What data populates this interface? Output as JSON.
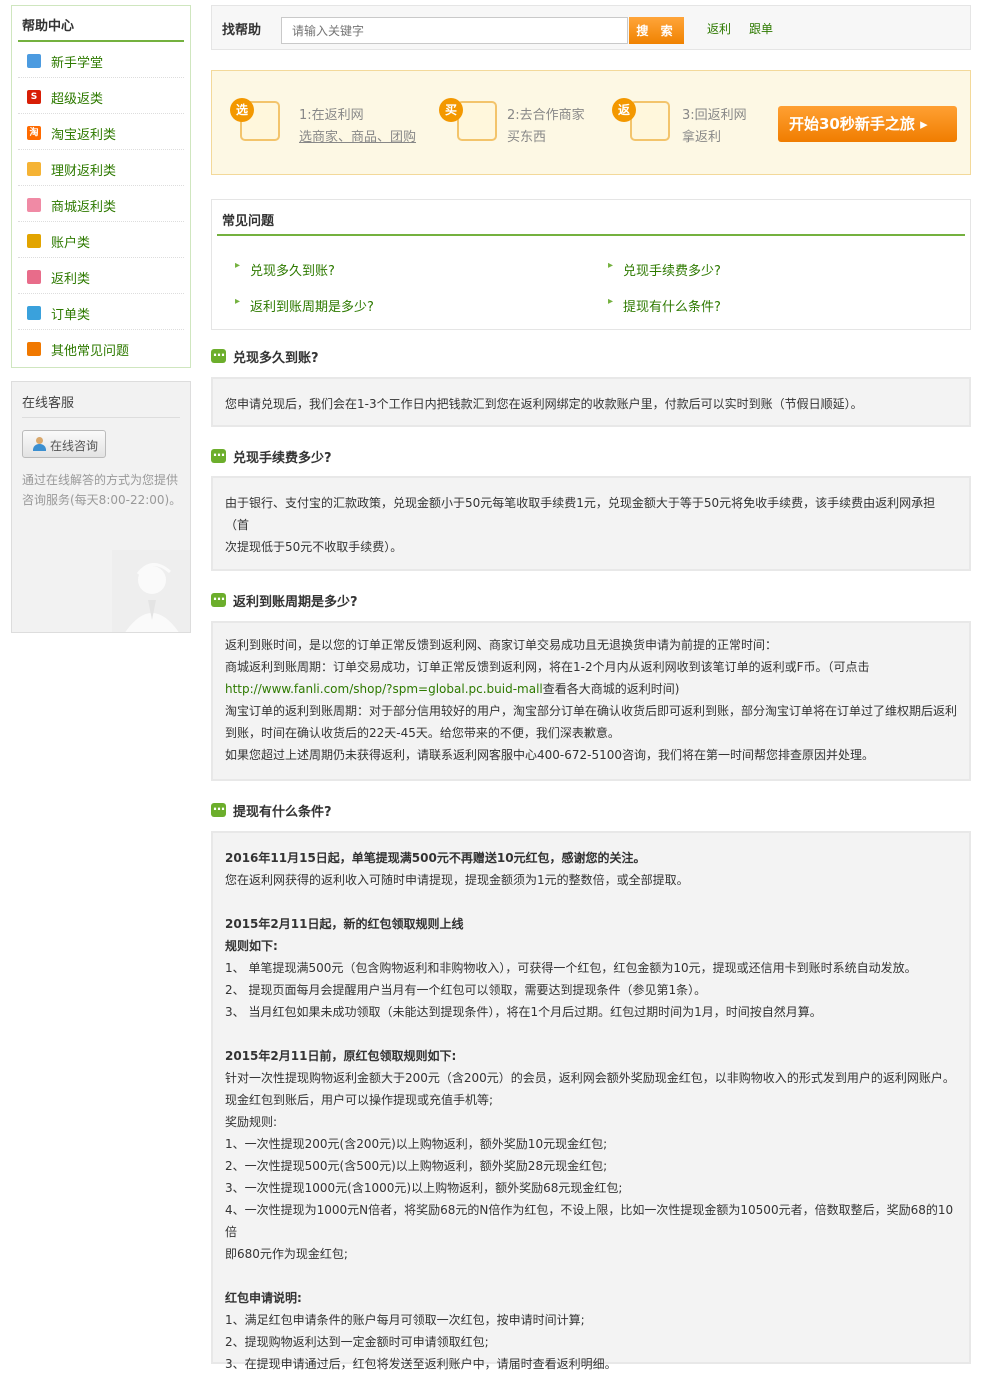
{
  "sidebar": {
    "title": "帮助中心",
    "items": [
      {
        "label": "新手学堂",
        "icon": "monitor-icon",
        "color": "#4c9be0",
        "glyph": ""
      },
      {
        "label": "超级返类",
        "icon": "super-s-icon",
        "color": "#d81e06",
        "glyph": "S"
      },
      {
        "label": "淘宝返利类",
        "icon": "taobao-icon",
        "color": "#ff6a00",
        "glyph": "淘"
      },
      {
        "label": "理财返利类",
        "icon": "wallet-icon",
        "color": "#f5b335",
        "glyph": ""
      },
      {
        "label": "商城返利类",
        "icon": "mall-icon",
        "color": "#f08aa5",
        "glyph": ""
      },
      {
        "label": "账户类",
        "icon": "lock-icon",
        "color": "#e2a400",
        "glyph": ""
      },
      {
        "label": "返利类",
        "icon": "piggy-bank-icon",
        "color": "#e86c8a",
        "glyph": ""
      },
      {
        "label": "订单类",
        "icon": "order-icon",
        "color": "#3aa1dc",
        "glyph": ""
      },
      {
        "label": "其他常见问题",
        "icon": "other-icon",
        "color": "#f07800",
        "glyph": ""
      }
    ],
    "service": {
      "title": "在线客服",
      "button": "在线咨询",
      "desc": "通过在线解答的方式为您提供咨询服务(每天8:00-22:00)。"
    }
  },
  "search": {
    "label": "找帮助",
    "placeholder": "请输入关键字",
    "button": "搜 索",
    "links": [
      "返利",
      "跟单"
    ]
  },
  "guide": {
    "steps": [
      {
        "badge": "选",
        "title": "1:在返利网",
        "sub": "选商家、商品、团购"
      },
      {
        "badge": "买",
        "title": "2:去合作商家",
        "sub": "买东西"
      },
      {
        "badge": "返",
        "title": "3:回返利网",
        "sub": "拿返利"
      }
    ],
    "start_button": "开始30秒新手之旅 ▸"
  },
  "faq": {
    "title": "常见问题",
    "links": [
      "兑现多久到账?",
      "兑现手续费多少?",
      "返利到账周期是多少?",
      "提现有什么条件?"
    ]
  },
  "qa": [
    {
      "question": "兑现多久到账?",
      "answer": [
        "您申请兑现后，我们会在1-3个工作日内把钱款汇到您在返利网绑定的收款账户里，付款后可以实时到账（节假日顺延）。"
      ]
    },
    {
      "question": "兑现手续费多少?",
      "answer": [
        "由于银行、支付宝的汇款政策，兑现金额小于50元每笔收取手续费1元，兑现金额大于等于50元将免收手续费，该手续费由返利网承担（首",
        "次提现低于50元不收取手续费）。"
      ]
    },
    {
      "question": "返利到账周期是多少?",
      "answer": [
        "返利到账时间，是以您的订单正常反馈到返利网、商家订单交易成功且无退换货申请为前提的正常时间：",
        "商城返利到账周期：订单交易成功，订单正常反馈到返利网，将在1-2个月内从返利网收到该笔订单的返利或F币。（可点击",
        "淘宝订单的返利到账周期：对于部分信用较好的用户，淘宝部分订单在确认收货后即可返利到账，部分淘宝订单将在订单过了维权期后返利",
        "到账，时间在确认收货后的22天-45天。给您带来的不便，我们深表歉意。",
        "如果您超过上述周期仍未获得返利，请联系返利网客服中心400-672-5100咨询，我们将在第一时间帮您排查原因并处理。"
      ],
      "answer_url": "http://www.fanli.com/shop/?spm=global.pc.buid-mall",
      "answer_url_suffix": "查看各大商城的返利时间)"
    },
    {
      "question": "提现有什么条件?",
      "answer": [
        "2016年11月15日起，单笔提现满500元不再赠送10元红包，感谢您的关注。",
        "您在返利网获得的返利收入可随时申请提现，提现金额须为1元的整数倍，或全部提取。",
        "",
        "2015年2月11日起，新的红包领取规则上线",
        "规则如下:",
        "1、 单笔提现满500元（包含购物返利和非购物收入），可获得一个红包，红包金额为10元，提现或还信用卡到账时系统自动发放。",
        "2、 提现页面每月会提醒用户当月有一个红包可以领取，需要达到提现条件（参见第1条）。",
        "3、 当月红包如果未成功领取（未能达到提现条件），将在1个月后过期。红包过期时间为1月，时间按自然月算。",
        "",
        "2015年2月11日前，原红包领取规则如下:",
        "针对一次性提现购物返利金额大于200元（含200元）的会员，返利网会额外奖励现金红包，以非购物收入的形式发到用户的返利网账户。",
        "现金红包到账后，用户可以操作提现或充值手机等;",
        "奖励规则:",
        "1、一次性提现200元(含200元)以上购物返利，额外奖励10元现金红包;",
        "2、一次性提现500元(含500元)以上购物返利，额外奖励28元现金红包;",
        "3、一次性提现1000元(含1000元)以上购物返利，额外奖励68元现金红包;",
        "4、一次性提现为1000元N倍者，将奖励68元的N倍作为红包，不设上限，比如一次性提现金额为10500元者，倍数取整后，奖励68的10倍",
        "即680元作为现金红包;",
        "",
        "红包申请说明:",
        "1、满足红包申请条件的账户每月可领取一次红包，按申请时间计算;",
        "2、提现购物返利达到一定金额时可申请领取红包;",
        "3、在提现申请通过后，红包将发送至返利账户中，请届时查看返利明细。"
      ]
    }
  ],
  "colors": {
    "brand_green": "#74b13f",
    "link_green": "#2e7a00",
    "orange": "#f39800"
  }
}
